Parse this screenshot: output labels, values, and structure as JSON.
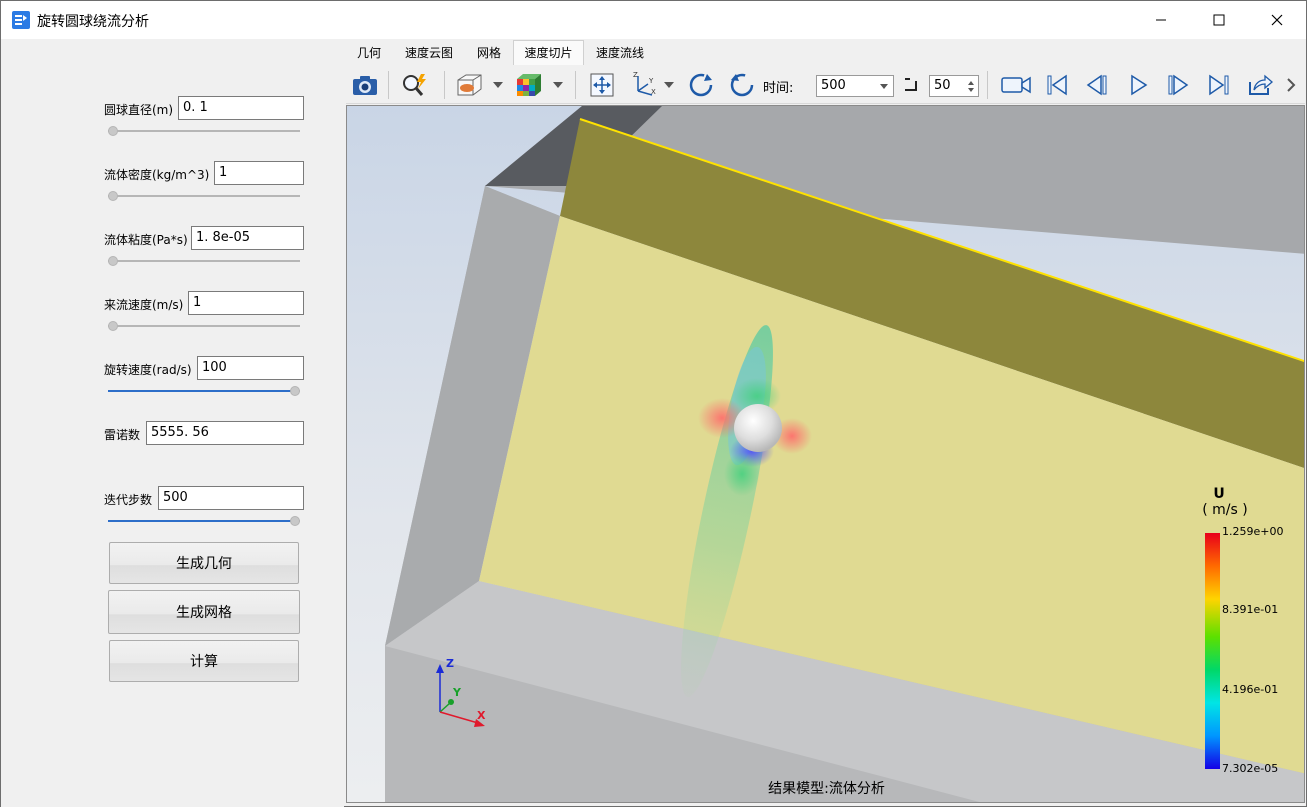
{
  "window": {
    "title": "旋转圆球绕流分析",
    "icon": "app-icon"
  },
  "params": [
    {
      "label": "圆球直径(m)",
      "value": "0. 1",
      "slider": 0.0
    },
    {
      "label": "流体密度(kg/m^3)",
      "value": "1",
      "slider": 0.0
    },
    {
      "label": "流体粘度(Pa*s)",
      "value": "1. 8e-05",
      "slider": 0.0
    },
    {
      "label": "来流速度(m/s)",
      "value": "1",
      "slider": 0.0
    },
    {
      "label": "旋转速度(rad/s)",
      "value": "100",
      "slider": 1.0
    },
    {
      "label": "雷诺数",
      "value": "5555. 56"
    },
    {
      "label": "迭代步数",
      "value": "500",
      "slider": 1.0
    }
  ],
  "buttons": {
    "generate_geometry": "生成几何",
    "generate_mesh": "生成网格",
    "compute": "计算"
  },
  "tabs": [
    {
      "label": "几何",
      "active": false
    },
    {
      "label": "速度云图",
      "active": false
    },
    {
      "label": "网格",
      "active": false
    },
    {
      "label": "速度切片",
      "active": true
    },
    {
      "label": "速度流线",
      "active": false
    }
  ],
  "toolbar": {
    "time_label": "时间:",
    "time_value": "500",
    "step_value": "50",
    "icons": [
      "camera-icon",
      "zoom-icon",
      "display-mode-icon",
      "color-cube-icon",
      "fit-view-icon",
      "axes-icon",
      "rotate-cw-icon",
      "rotate-ccw-icon",
      "record-icon",
      "first-frame-icon",
      "prev-frame-icon",
      "play-icon",
      "next-frame-icon",
      "last-frame-icon",
      "export-icon"
    ]
  },
  "viewport": {
    "status": "结果模型:流体分析",
    "axes": {
      "z": "Z",
      "y": "Y",
      "x": "X"
    },
    "colorbar": {
      "title": "U",
      "unit": "( m/s )",
      "ticks": [
        "1.259e+00",
        "8.391e-01",
        "4.196e-01",
        "7.302e-05"
      ]
    }
  },
  "colors": {
    "accent": "#2d6ec9",
    "slice_plane": "#e0da92",
    "top_plane": "#8d873c",
    "edge_highlight": "#ffe200"
  }
}
